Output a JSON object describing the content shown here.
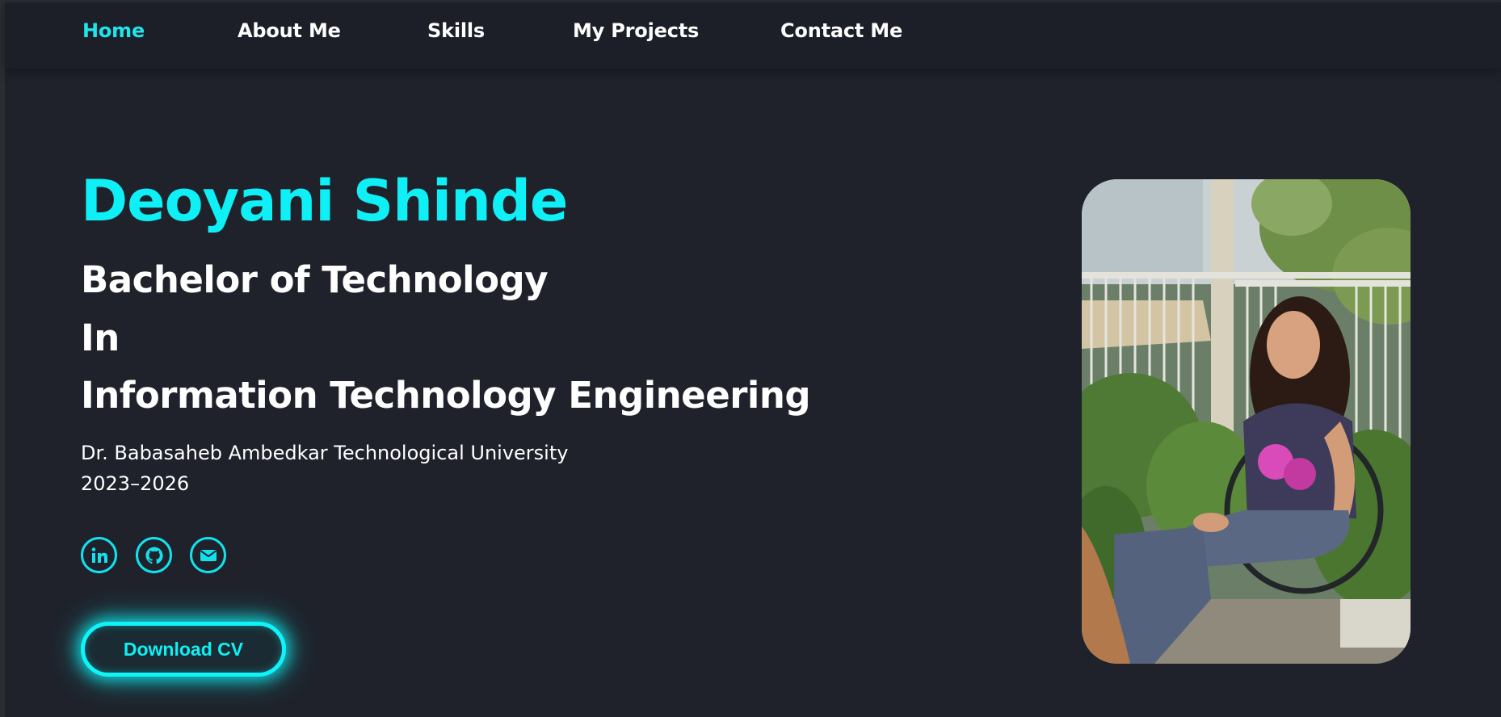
{
  "nav": {
    "items": [
      {
        "label": "Home",
        "active": true
      },
      {
        "label": "About Me",
        "active": false
      },
      {
        "label": "Skills",
        "active": false
      },
      {
        "label": "My Projects",
        "active": false
      },
      {
        "label": "Contact Me",
        "active": false
      }
    ]
  },
  "hero": {
    "name": "Deoyani Shinde",
    "degree_lines": [
      "Bachelor of Technology",
      "In",
      "Information Technology Engineering"
    ],
    "university": "Dr. Babasaheb Ambedkar Technological University",
    "years": "2023–2026",
    "social_icons": [
      "linkedin-icon",
      "github-icon",
      "email-icon"
    ],
    "cta_label": "Download CV"
  },
  "colors": {
    "background": "#1f222b",
    "navbar": "#1c1f27",
    "accent": "#0ff0f6",
    "text": "#ffffff"
  }
}
